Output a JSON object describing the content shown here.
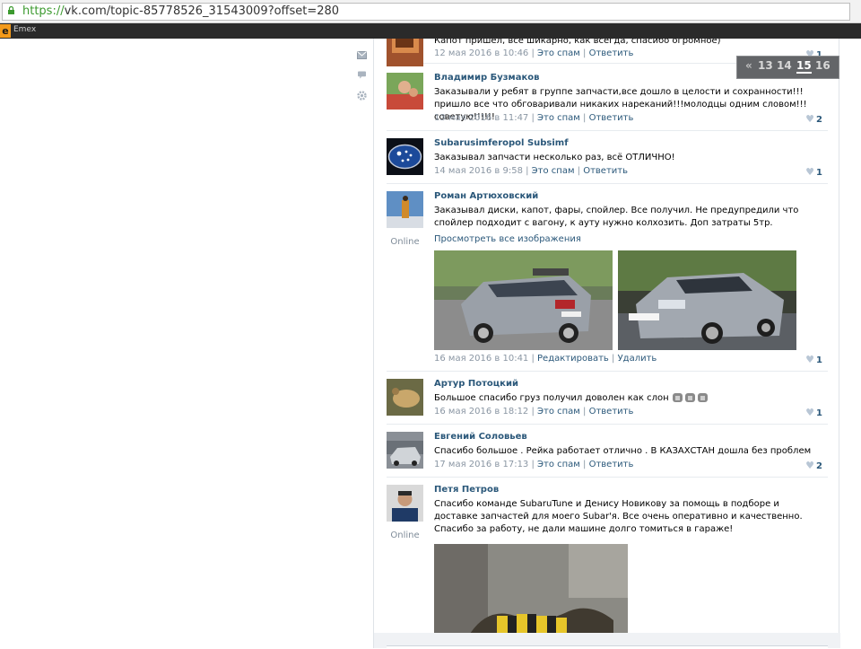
{
  "browser": {
    "url_protocol": "https://",
    "url_rest": "vk.com/topic-85778526_31543009?offset=280",
    "bookmark_label": "Emex",
    "bookmark_icon_letter": "e"
  },
  "pager": {
    "prev": "«",
    "pages": [
      "13",
      "14",
      "15",
      "16"
    ],
    "current": "15"
  },
  "posts": [
    {
      "text": "Капот пришёл, всё шикарно, как всегда, спасибо огромное)",
      "date": "12 мая 2016 в 10:46",
      "spam": "Это спам",
      "reply": "Ответить",
      "likes": "1"
    },
    {
      "name": "Владимир Бузмаков",
      "text": "Заказывали у ребят в группе запчасти,все дошло в целости и сохранности!!!пришло все что обговаривали никаких нареканий!!!молодцы одним словом!!!советую!!!!!!",
      "date": "13 мая 2016 в 11:47",
      "spam": "Это спам",
      "reply": "Ответить",
      "likes": "2"
    },
    {
      "name": "Subarusimferopol Subsimf",
      "text": "Заказывал запчасти несколько раз, всё ОТЛИЧНО!",
      "date": "14 мая 2016 в 9:58",
      "spam": "Это спам",
      "reply": "Ответить",
      "likes": "1"
    },
    {
      "name": "Роман Артюховский",
      "text": "Заказывал диски, капот, фары, спойлер. Все получил. Не предупредили что спойлер подходит с вагону, к ауту нужно колхозить. Доп затраты 5тр.",
      "online": "Online",
      "view_all": "Просмотреть все изображения",
      "date": "16 мая 2016 в 10:41",
      "edit": "Редактировать",
      "delete": "Удалить",
      "likes": "1"
    },
    {
      "name": "Артур Потоцкий",
      "text": "Большое спасибо груз получил доволен как слон",
      "date": "16 мая 2016 в 18:12",
      "spam": "Это спам",
      "reply": "Ответить",
      "likes": "1"
    },
    {
      "name": "Евгений Соловьев",
      "text": "Спасибо большое . Рейка работает отлично . В КАЗАХСТАН дошла без проблем",
      "date": "17 мая 2016 в 17:13",
      "spam": "Это спам",
      "reply": "Ответить",
      "likes": "2"
    },
    {
      "name": "Петя Петров",
      "text": "Спасибо команде SubaruTune и Денису Новикову за помощь в подборе и доставке запчастей для моего Subar'я. Все очень оперативно и качественно. Спасибо за работу, не дали машине долго томиться в гараже!",
      "online": "Online"
    }
  ],
  "colors": {
    "link": "#2b587a",
    "meta": "#8a96a3",
    "pager_bg": "#636568"
  },
  "icons": [
    "mail-icon",
    "comment-icon",
    "settings-icon",
    "heart-icon",
    "lock-icon"
  ]
}
